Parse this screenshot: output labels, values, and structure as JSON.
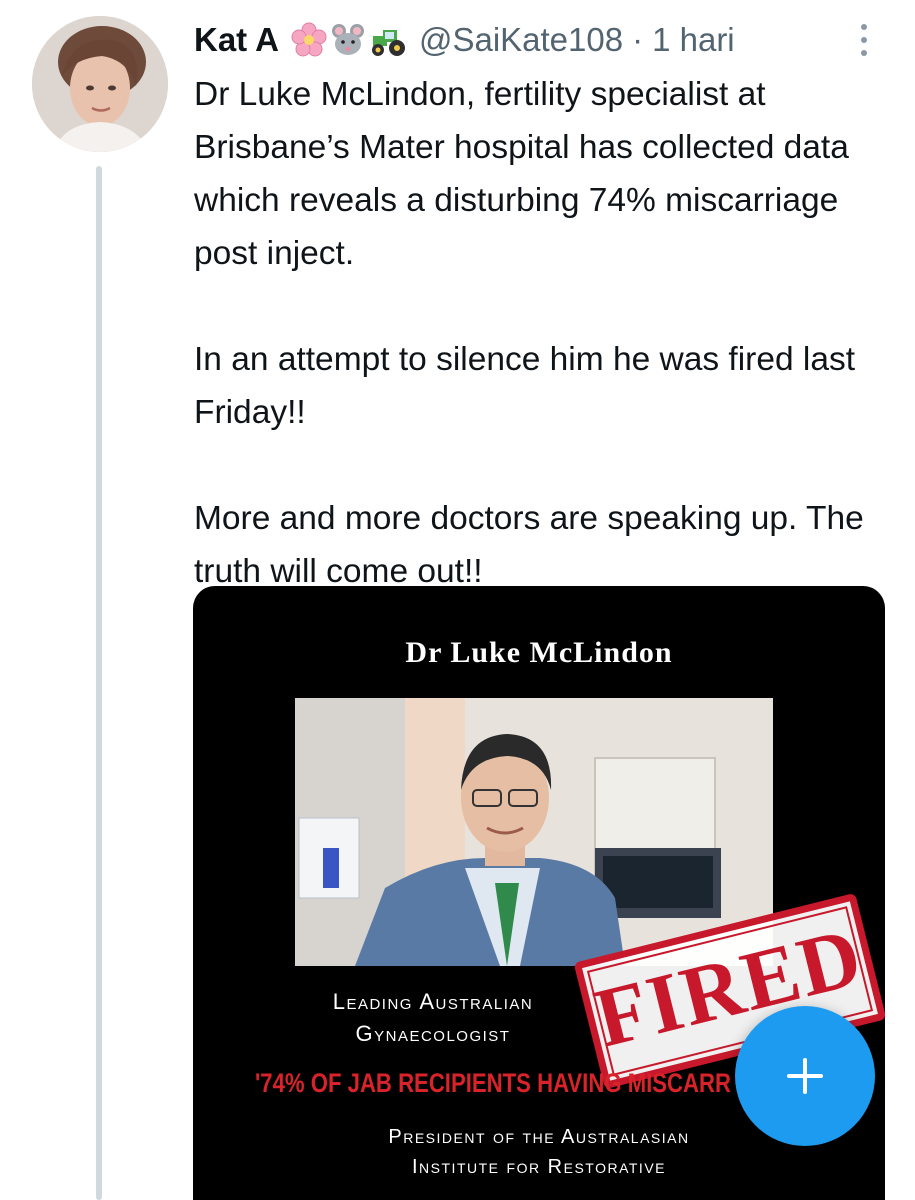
{
  "author": {
    "display_name": "Kat A",
    "emojis": [
      "cherry-blossom-icon",
      "mouse-icon",
      "tractor-icon"
    ],
    "handle": "@SaiKate108",
    "separator": "·",
    "timestamp": "1 hari"
  },
  "tweet": {
    "paragraphs": [
      "Dr Luke McLindon, fertility specialist at Brisbane’s Mater hospital has collected data which reveals a disturbing 74% miscarriage post inject.",
      "In an attempt to silence him he was fired last Friday!!",
      "More and more doctors are speaking up. The truth will come out!!"
    ]
  },
  "media": {
    "title": "Dr Luke McLindon",
    "caption_line1": "Leading Australian",
    "caption_line2": "Gynaecologist",
    "claim": "'74% OF JAB RECIPIENTS HAVING MISCARR",
    "caption_line3": "President of the Australasian",
    "caption_line4": "Institute for Restorative",
    "stamp_text": "FIRED"
  },
  "fab": {
    "icon": "plus-icon",
    "color": "#1d9bf0"
  },
  "colors": {
    "text_primary": "#0f1419",
    "text_secondary": "#536471",
    "thread_line": "#cfd9de",
    "stamp_red": "#c8192c",
    "claim_red": "#d8232a"
  }
}
